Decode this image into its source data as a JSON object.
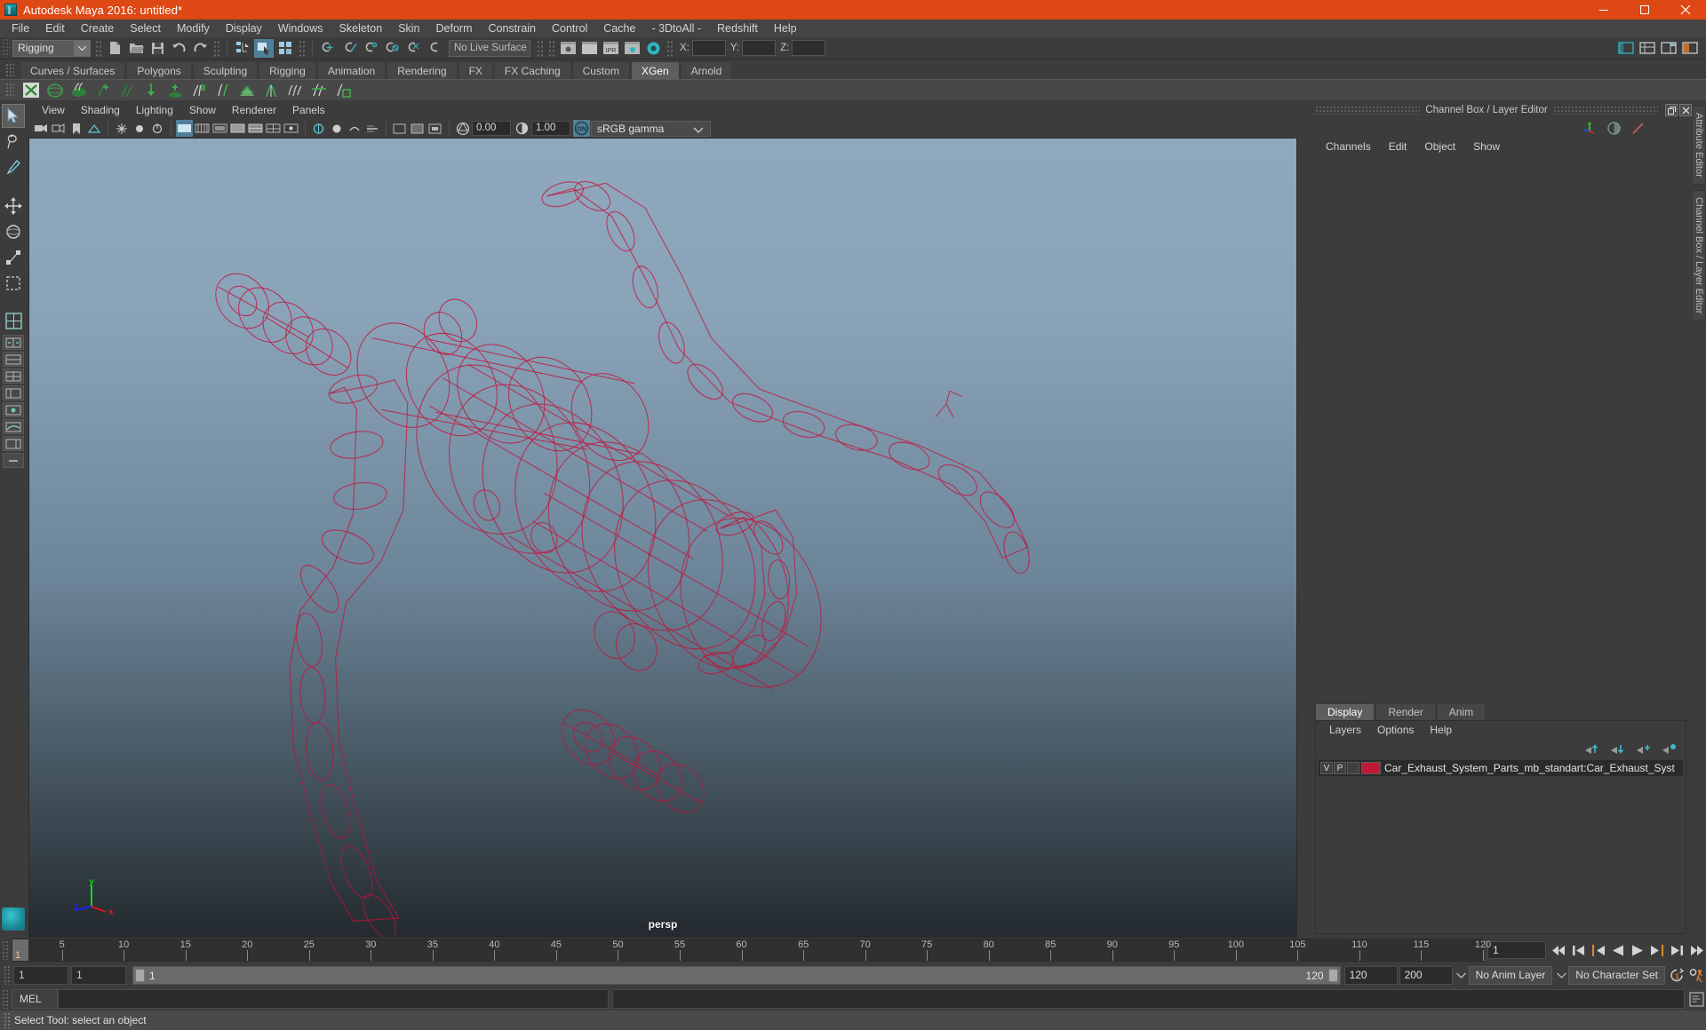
{
  "window": {
    "title": "Autodesk Maya 2016: untitled*",
    "icon": "maya-logo-icon",
    "controls": {
      "minimize": "minimize-icon",
      "maximize": "maximize-icon",
      "close": "close-icon"
    },
    "accent_color": "#dd4814"
  },
  "menubar": {
    "items": [
      "File",
      "Edit",
      "Create",
      "Select",
      "Modify",
      "Display",
      "Windows",
      "Skeleton",
      "Skin",
      "Deform",
      "Constrain",
      "Control",
      "Cache",
      "- 3DtoAll -",
      "Redshift",
      "Help"
    ]
  },
  "statusbar": {
    "menu_set": "Rigging",
    "live_surface": "No Live Surface",
    "coord_labels": {
      "x": "X:",
      "y": "Y:",
      "z": "Z:"
    },
    "coord_values": {
      "x": "",
      "y": "",
      "z": ""
    },
    "icons": [
      "new-scene-icon",
      "open-scene-icon",
      "save-scene-icon",
      "undo-icon",
      "redo-icon",
      "select-hierarchy-icon",
      "select-object-icon",
      "select-component-icon",
      "snap-to-grid-icon",
      "snap-to-curve-icon",
      "snap-to-point-icon",
      "snap-to-projected-center-icon",
      "snap-to-view-plane-icon",
      "make-live-icon",
      "render-view-icon",
      "render-current-frame-icon",
      "ipr-render-icon",
      "render-settings-icon",
      "hypershade-icon",
      "show-editor-icon",
      "attribute-editor-icon",
      "channel-box-icon",
      "modeling-toolkit-icon"
    ]
  },
  "shelf": {
    "tabs": [
      "Curves / Surfaces",
      "Polygons",
      "Sculpting",
      "Rigging",
      "Animation",
      "Rendering",
      "FX",
      "FX Caching",
      "Custom",
      "XGen",
      "Arnold"
    ],
    "active_tab": "XGen",
    "buttons": [
      "xgen-create-description-icon",
      "xgen-sphere-icon",
      "xgen-hair-icon",
      "xgen-add-guide-icon",
      "xgen-guide-icon",
      "xgen-density-brush-icon",
      "xgen-width-brush-icon",
      "xgen-mask-brush-icon",
      "xgen-region-brush-icon",
      "xgen-preview-icon",
      "xgen-clump-icon",
      "xgen-noise-icon",
      "xgen-cut-icon",
      "xgen-collision-icon"
    ]
  },
  "toolbox": {
    "tools": [
      {
        "name": "select-tool",
        "selected": true
      },
      {
        "name": "lasso-select-tool",
        "selected": false
      },
      {
        "name": "paint-select-tool",
        "selected": false
      },
      {
        "name": "move-tool",
        "selected": false
      },
      {
        "name": "rotate-tool",
        "selected": false
      },
      {
        "name": "scale-tool",
        "selected": false
      },
      {
        "name": "last-tool-used",
        "selected": false
      }
    ],
    "layout_buttons": [
      "single-perspective-layout-icon",
      "two-pane-side-layout-icon",
      "two-pane-stacked-layout-icon",
      "four-pane-layout-icon",
      "persp-outliner-layout-icon",
      "hypershade-layout-icon",
      "persp-graph-layout-icon",
      "outliner-persp-layout-icon",
      "expand-layout-icon"
    ],
    "logo": "maya-icon"
  },
  "viewport": {
    "menus": [
      "View",
      "Shading",
      "Lighting",
      "Show",
      "Renderer",
      "Panels"
    ],
    "camera_label": "persp",
    "exposure_value": "0.00",
    "gamma_value": "1.00",
    "color_management": "sRGB gamma",
    "color_management_enabled": "ON",
    "axis_gizmo": {
      "x": "x",
      "y": "y",
      "z": "z"
    },
    "toolbar_icons": [
      "select-camera-icon",
      "camera-attributes-icon",
      "bookmarks-icon",
      "image-plane-icon",
      "two-sided-lighting-icon",
      "shadows-icon",
      "ambient-occlusion-icon",
      "motion-blur-icon",
      "wireframe-shading-icon",
      "smooth-shade-all-icon",
      "smooth-shade-selected-icon",
      "flat-shade-icon",
      "wireframe-on-shaded-icon",
      "texture-icon",
      "lights-icon",
      "shadow-icon",
      "screen-space-ao-icon",
      "multisample-icon",
      "depth-peel-icon",
      "xray-icon",
      "xray-joints-icon",
      "xray-active-components-icon",
      "exposure-icon",
      "contrast-icon",
      "color-management-toggle-icon"
    ]
  },
  "right_panel": {
    "title": "Channel Box / Layer Editor",
    "window_buttons": [
      "undock-icon",
      "close-icon"
    ],
    "channel_box": {
      "menus": [
        "Channels",
        "Edit",
        "Object",
        "Show"
      ],
      "icons": [
        "channel-box-icon",
        "attribute-editor-icon",
        "modeling-toolkit-icon"
      ],
      "rows": []
    },
    "layer_editor": {
      "tabs": [
        "Display",
        "Render",
        "Anim"
      ],
      "active_tab": "Display",
      "menus": [
        "Layers",
        "Options",
        "Help"
      ],
      "buttons": [
        "move-layer-up-icon",
        "move-layer-down-icon",
        "new-layer-icon",
        "new-layer-from-selected-icon"
      ],
      "layers": [
        {
          "visibility": "V",
          "playback": "P",
          "shading": "",
          "color": "#c01838",
          "name": "Car_Exhaust_System_Parts_mb_standart:Car_Exhaust_Syst"
        }
      ]
    },
    "side_tabs": [
      "Attribute Editor",
      "Channel Box / Layer Editor"
    ]
  },
  "timeline": {
    "ticks": [
      5,
      10,
      15,
      20,
      25,
      30,
      35,
      40,
      45,
      50,
      55,
      60,
      65,
      70,
      75,
      80,
      85,
      90,
      95,
      100,
      105,
      110,
      115,
      120
    ],
    "current_frame": "1",
    "current_frame_field": "1",
    "range_start": "1",
    "range_end": "1",
    "range_bar_start": "1",
    "range_bar_end": "120",
    "playback_end": "120",
    "animation_end": "200",
    "anim_layer": "No Anim Layer",
    "character_set": "No Character Set",
    "playback_buttons": [
      "go-to-start-icon",
      "step-back-keyframe-icon",
      "step-back-frame-icon",
      "play-backwards-icon",
      "play-forwards-icon",
      "step-forward-frame-icon",
      "step-forward-keyframe-icon",
      "go-to-end-icon"
    ],
    "extra_buttons": [
      "auto-keyframe-icon",
      "animation-preferences-icon"
    ]
  },
  "command_line": {
    "language": "MEL",
    "input_value": "",
    "output_value": "",
    "script_editor_button": "script-editor-icon"
  },
  "status_line": {
    "message": "Select Tool: select an object"
  }
}
